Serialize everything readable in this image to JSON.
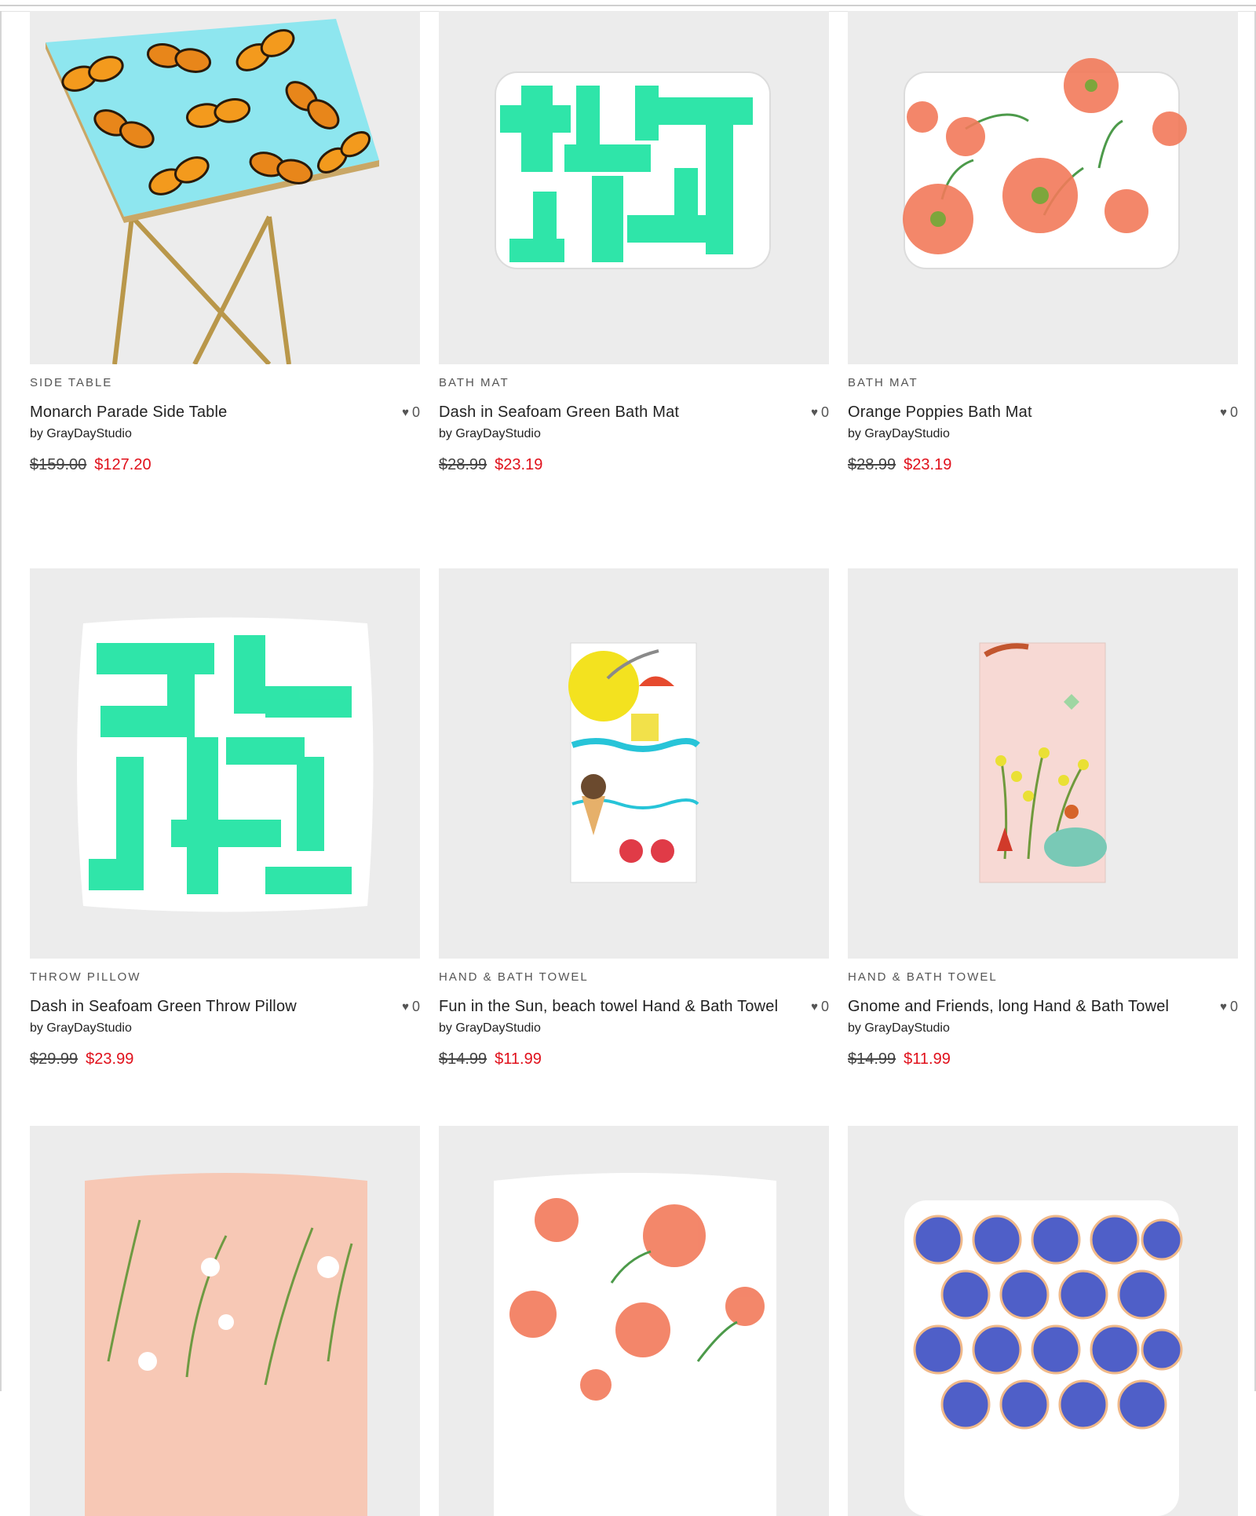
{
  "products": [
    {
      "category": "SIDE TABLE",
      "title": "Monarch Parade Side Table",
      "artist": "by GrayDayStudio",
      "likes": "0",
      "original_price": "$159.00",
      "sale_price": "$127.20"
    },
    {
      "category": "BATH MAT",
      "title": "Dash in Seafoam Green Bath Mat",
      "artist": "by GrayDayStudio",
      "likes": "0",
      "original_price": "$28.99",
      "sale_price": "$23.19"
    },
    {
      "category": "BATH MAT",
      "title": "Orange Poppies Bath Mat",
      "artist": "by GrayDayStudio",
      "likes": "0",
      "original_price": "$28.99",
      "sale_price": "$23.19"
    },
    {
      "category": "THROW PILLOW",
      "title": "Dash in Seafoam Green Throw Pillow",
      "artist": "by GrayDayStudio",
      "likes": "0",
      "original_price": "$29.99",
      "sale_price": "$23.99"
    },
    {
      "category": "HAND & BATH TOWEL",
      "title": "Fun in the Sun, beach towel Hand & Bath Towel",
      "artist": "by GrayDayStudio",
      "likes": "0",
      "original_price": "$14.99",
      "sale_price": "$11.99"
    },
    {
      "category": "HAND & BATH TOWEL",
      "title": "Gnome and Friends, long Hand & Bath Towel",
      "artist": "by GrayDayStudio",
      "likes": "0",
      "original_price": "$14.99",
      "sale_price": "$11.99"
    }
  ],
  "icons": {
    "like": "heart-icon"
  },
  "colors": {
    "sale": "#e0101b",
    "seafoam": "#1ee3a2",
    "butterfly_bg": "#8ee6ef",
    "poppy": "#f27a5a"
  }
}
